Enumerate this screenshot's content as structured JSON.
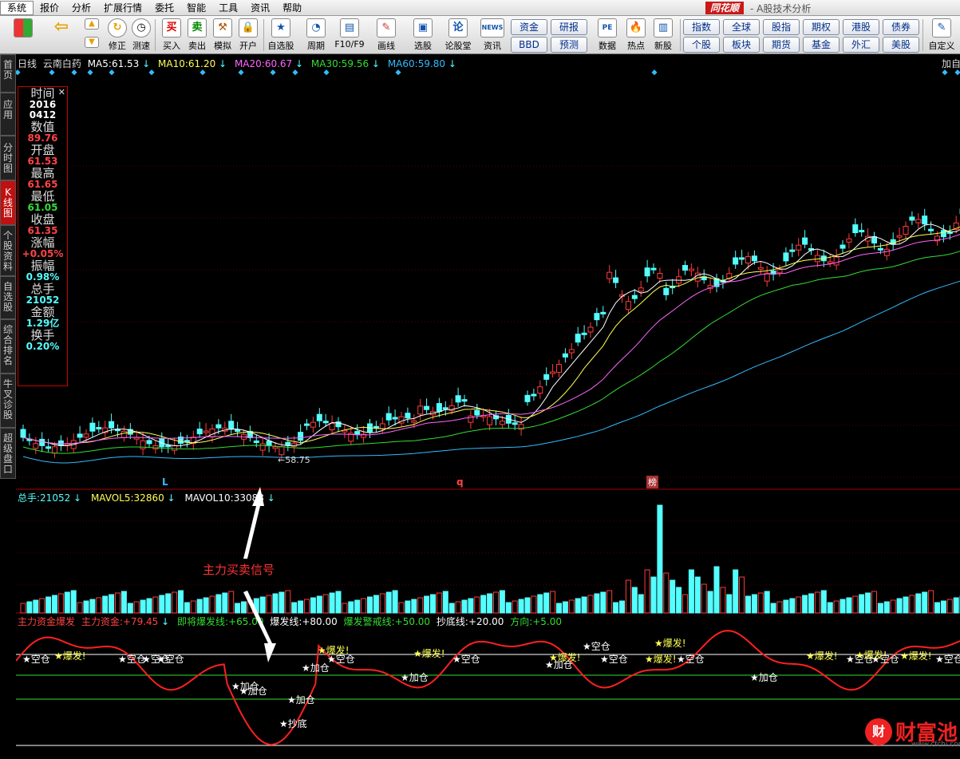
{
  "menubar": {
    "items": [
      "系统",
      "报价",
      "分析",
      "扩展行情",
      "委托",
      "智能",
      "工具",
      "资讯",
      "帮助"
    ],
    "brand": "同花顺",
    "subtitle": "- A股技术分析"
  },
  "toolbar": {
    "buttons": [
      "修正",
      "测速",
      "买入",
      "卖出",
      "模拟",
      "开户",
      "自选股",
      "周期",
      "F10/F9",
      "画线",
      "选股",
      "论股堂",
      "资讯",
      "数据",
      "热点",
      "新股",
      "自定义"
    ],
    "icons": {
      "buy": "买",
      "sell": "卖",
      "news": "NEWS"
    },
    "group1": [
      "资金",
      "研报",
      "BBD",
      "预测"
    ],
    "group2": [
      "指数",
      "全球",
      "股指",
      "期权",
      "港股",
      "债券",
      "个股",
      "板块",
      "期货",
      "基金",
      "外汇",
      "美股"
    ]
  },
  "sidebar": {
    "tabs": [
      "首页",
      "应用",
      "分时图",
      "K线图",
      "个股资料",
      "自选股",
      "综合排名",
      "牛叉诊股",
      "超级盘口"
    ]
  },
  "header": {
    "period": "日线",
    "stock": "云南白药",
    "ma5_label": "MA5:",
    "ma5": "61.53",
    "ma10_label": "MA10:",
    "ma10": "61.20",
    "ma20_label": "MA20:",
    "ma20": "60.67",
    "ma30_label": "MA30:",
    "ma30": "59.56",
    "ma60_label": "MA60:",
    "ma60": "59.80",
    "right": "加自"
  },
  "infobox": {
    "time_label": "时间",
    "date1": "2016",
    "date2": "0412",
    "value_label": "数值",
    "value": "89.76",
    "open_label": "开盘",
    "open": "61.53",
    "high_label": "最高",
    "high": "61.65",
    "low_label": "最低",
    "low": "61.05",
    "close_label": "收盘",
    "close": "61.35",
    "chg_label": "涨幅",
    "chg": "+0.05%",
    "amp_label": "振幅",
    "amp": "0.98%",
    "vol_label": "总手",
    "vol": "21052",
    "amt_label": "金额",
    "amt": "1.29亿",
    "turn_label": "换手",
    "turn": "0.20%"
  },
  "markers": {
    "low_price": "58.75",
    "L": "L",
    "q": "q",
    "bang": "榜"
  },
  "volume": {
    "label": "总手:",
    "value": "21052",
    "mavol5_label": "MAVOL5:",
    "mavol5": "32860",
    "mavol10_label": "MAVOL10:",
    "mavol10": "33088"
  },
  "indicator": {
    "name": "主力资金爆发",
    "main_label": "主力资金:",
    "main": "+79.45",
    "l1": "即将爆发线:",
    "v1": "+65.00",
    "l2": "爆发线:",
    "v2": "+80.00",
    "l3": "爆发警戒线:",
    "v3": "+50.00",
    "l4": "抄底线:",
    "v4": "+20.00",
    "l5": "方向:",
    "v5": "+5.00"
  },
  "annotation": "主力买卖信号",
  "signals": [
    "空仓",
    "爆发!",
    "空仓",
    "空仓",
    "加仓",
    "加仓",
    "加仓",
    "抄底",
    "加仓",
    "爆发!",
    "空仓",
    "爆发!",
    "加仓",
    "空仓",
    "加仓",
    "爆发!",
    "空仓",
    "爆发!",
    "空仓",
    "爆发!",
    "加仓",
    "空仓",
    "空仓",
    "爆发!",
    "空仓",
    "爆发!",
    "空仓",
    "爆发!",
    "空仓"
  ],
  "watermark": {
    "text": "财富池",
    "url": "www.cfchi.com"
  },
  "colors": {
    "up": "#ff3b3b",
    "down": "#54ffff",
    "ma5": "#ffffff",
    "ma10": "#ffff55",
    "ma20": "#ff66ff",
    "ma30": "#33dd33",
    "ma60": "#33bbff",
    "indicator": "#ff2020"
  }
}
